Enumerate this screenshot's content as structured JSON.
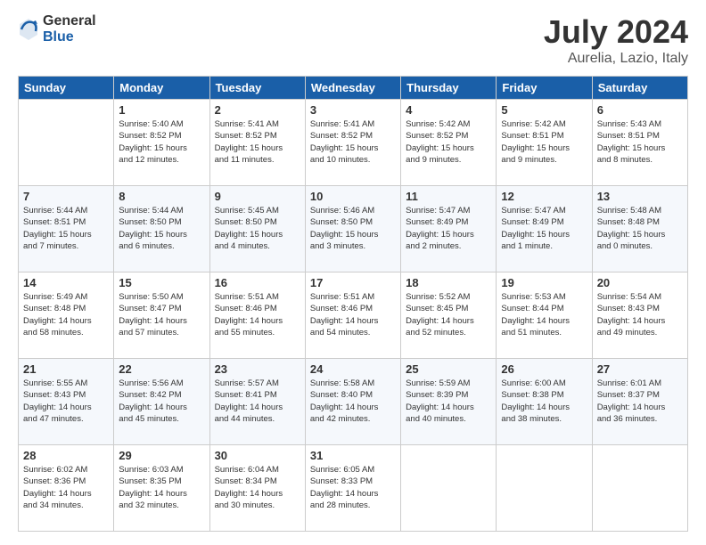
{
  "logo": {
    "general": "General",
    "blue": "Blue"
  },
  "header": {
    "month_year": "July 2024",
    "location": "Aurelia, Lazio, Italy"
  },
  "weekdays": [
    "Sunday",
    "Monday",
    "Tuesday",
    "Wednesday",
    "Thursday",
    "Friday",
    "Saturday"
  ],
  "weeks": [
    [
      {
        "day": "",
        "info": ""
      },
      {
        "day": "1",
        "info": "Sunrise: 5:40 AM\nSunset: 8:52 PM\nDaylight: 15 hours\nand 12 minutes."
      },
      {
        "day": "2",
        "info": "Sunrise: 5:41 AM\nSunset: 8:52 PM\nDaylight: 15 hours\nand 11 minutes."
      },
      {
        "day": "3",
        "info": "Sunrise: 5:41 AM\nSunset: 8:52 PM\nDaylight: 15 hours\nand 10 minutes."
      },
      {
        "day": "4",
        "info": "Sunrise: 5:42 AM\nSunset: 8:52 PM\nDaylight: 15 hours\nand 9 minutes."
      },
      {
        "day": "5",
        "info": "Sunrise: 5:42 AM\nSunset: 8:51 PM\nDaylight: 15 hours\nand 9 minutes."
      },
      {
        "day": "6",
        "info": "Sunrise: 5:43 AM\nSunset: 8:51 PM\nDaylight: 15 hours\nand 8 minutes."
      }
    ],
    [
      {
        "day": "7",
        "info": "Sunrise: 5:44 AM\nSunset: 8:51 PM\nDaylight: 15 hours\nand 7 minutes."
      },
      {
        "day": "8",
        "info": "Sunrise: 5:44 AM\nSunset: 8:50 PM\nDaylight: 15 hours\nand 6 minutes."
      },
      {
        "day": "9",
        "info": "Sunrise: 5:45 AM\nSunset: 8:50 PM\nDaylight: 15 hours\nand 4 minutes."
      },
      {
        "day": "10",
        "info": "Sunrise: 5:46 AM\nSunset: 8:50 PM\nDaylight: 15 hours\nand 3 minutes."
      },
      {
        "day": "11",
        "info": "Sunrise: 5:47 AM\nSunset: 8:49 PM\nDaylight: 15 hours\nand 2 minutes."
      },
      {
        "day": "12",
        "info": "Sunrise: 5:47 AM\nSunset: 8:49 PM\nDaylight: 15 hours\nand 1 minute."
      },
      {
        "day": "13",
        "info": "Sunrise: 5:48 AM\nSunset: 8:48 PM\nDaylight: 15 hours\nand 0 minutes."
      }
    ],
    [
      {
        "day": "14",
        "info": "Sunrise: 5:49 AM\nSunset: 8:48 PM\nDaylight: 14 hours\nand 58 minutes."
      },
      {
        "day": "15",
        "info": "Sunrise: 5:50 AM\nSunset: 8:47 PM\nDaylight: 14 hours\nand 57 minutes."
      },
      {
        "day": "16",
        "info": "Sunrise: 5:51 AM\nSunset: 8:46 PM\nDaylight: 14 hours\nand 55 minutes."
      },
      {
        "day": "17",
        "info": "Sunrise: 5:51 AM\nSunset: 8:46 PM\nDaylight: 14 hours\nand 54 minutes."
      },
      {
        "day": "18",
        "info": "Sunrise: 5:52 AM\nSunset: 8:45 PM\nDaylight: 14 hours\nand 52 minutes."
      },
      {
        "day": "19",
        "info": "Sunrise: 5:53 AM\nSunset: 8:44 PM\nDaylight: 14 hours\nand 51 minutes."
      },
      {
        "day": "20",
        "info": "Sunrise: 5:54 AM\nSunset: 8:43 PM\nDaylight: 14 hours\nand 49 minutes."
      }
    ],
    [
      {
        "day": "21",
        "info": "Sunrise: 5:55 AM\nSunset: 8:43 PM\nDaylight: 14 hours\nand 47 minutes."
      },
      {
        "day": "22",
        "info": "Sunrise: 5:56 AM\nSunset: 8:42 PM\nDaylight: 14 hours\nand 45 minutes."
      },
      {
        "day": "23",
        "info": "Sunrise: 5:57 AM\nSunset: 8:41 PM\nDaylight: 14 hours\nand 44 minutes."
      },
      {
        "day": "24",
        "info": "Sunrise: 5:58 AM\nSunset: 8:40 PM\nDaylight: 14 hours\nand 42 minutes."
      },
      {
        "day": "25",
        "info": "Sunrise: 5:59 AM\nSunset: 8:39 PM\nDaylight: 14 hours\nand 40 minutes."
      },
      {
        "day": "26",
        "info": "Sunrise: 6:00 AM\nSunset: 8:38 PM\nDaylight: 14 hours\nand 38 minutes."
      },
      {
        "day": "27",
        "info": "Sunrise: 6:01 AM\nSunset: 8:37 PM\nDaylight: 14 hours\nand 36 minutes."
      }
    ],
    [
      {
        "day": "28",
        "info": "Sunrise: 6:02 AM\nSunset: 8:36 PM\nDaylight: 14 hours\nand 34 minutes."
      },
      {
        "day": "29",
        "info": "Sunrise: 6:03 AM\nSunset: 8:35 PM\nDaylight: 14 hours\nand 32 minutes."
      },
      {
        "day": "30",
        "info": "Sunrise: 6:04 AM\nSunset: 8:34 PM\nDaylight: 14 hours\nand 30 minutes."
      },
      {
        "day": "31",
        "info": "Sunrise: 6:05 AM\nSunset: 8:33 PM\nDaylight: 14 hours\nand 28 minutes."
      },
      {
        "day": "",
        "info": ""
      },
      {
        "day": "",
        "info": ""
      },
      {
        "day": "",
        "info": ""
      }
    ]
  ]
}
